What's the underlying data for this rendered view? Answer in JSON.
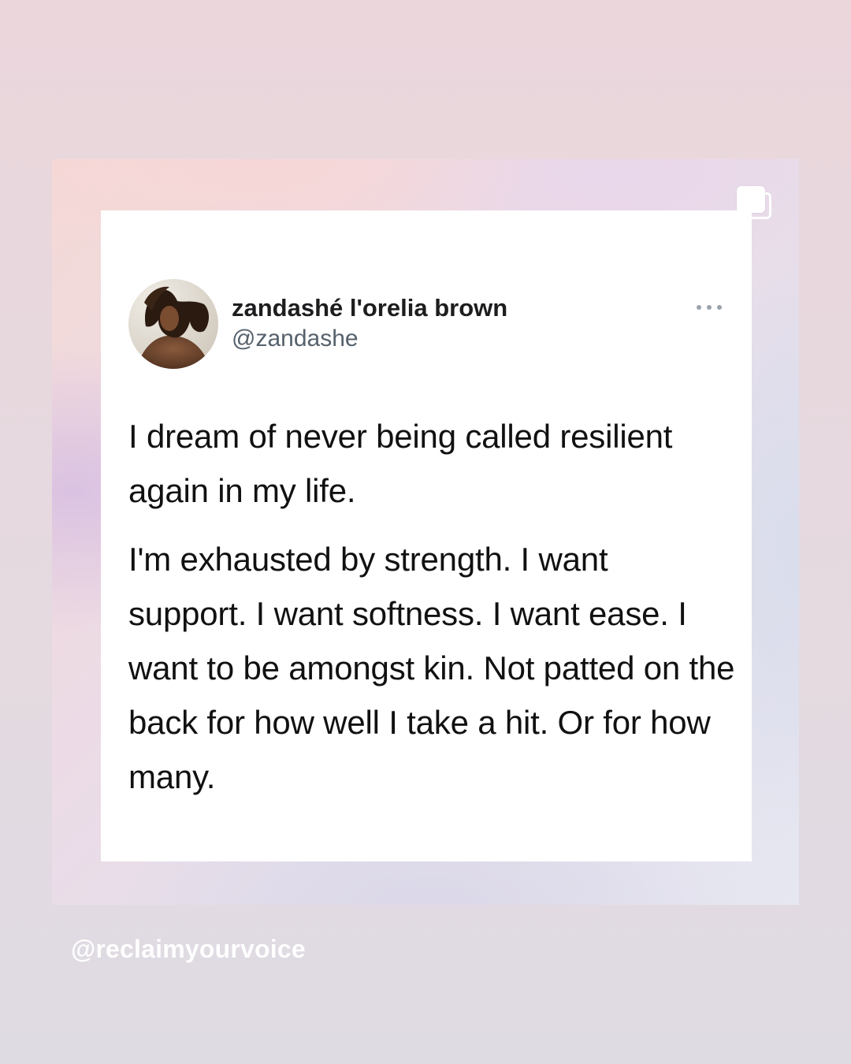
{
  "tweet": {
    "display_name": "zandashé l'orelia brown",
    "handle": "@zandashe",
    "paragraph_1": "I dream of never being called resilient again in my life.",
    "paragraph_2": "I'm exhausted by strength. I want support. I want softness. I want ease. I want to be amongst kin. Not patted on the back for how well I take a hit. Or for how many."
  },
  "watermark": "@reclaimyourvoice",
  "icons": {
    "more": "more-horizontal-icon",
    "multiple_images": "multiple-images-icon",
    "avatar": "profile-avatar"
  },
  "colors": {
    "display_name": "#1d1d1f",
    "handle": "#56616b",
    "text": "#111111",
    "card": "#ffffff"
  }
}
